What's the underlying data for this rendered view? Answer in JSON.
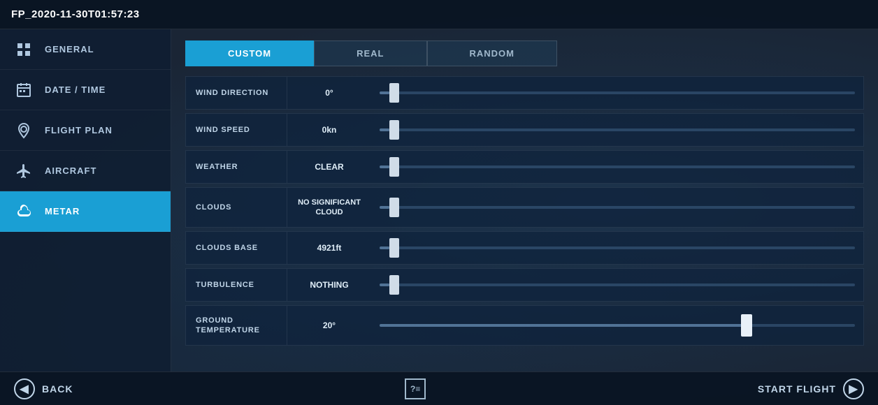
{
  "header": {
    "title": "FP_2020-11-30T01:57:23"
  },
  "sidebar": {
    "items": [
      {
        "id": "general",
        "label": "GENERAL",
        "icon": "grid-icon",
        "active": false
      },
      {
        "id": "datetime",
        "label": "DATE / TIME",
        "icon": "calendar-icon",
        "active": false
      },
      {
        "id": "flightplan",
        "label": "FLIGHT PLAN",
        "icon": "location-icon",
        "active": false
      },
      {
        "id": "aircraft",
        "label": "AIRCRAFT",
        "icon": "plane-icon",
        "active": false
      },
      {
        "id": "metar",
        "label": "METAR",
        "icon": "metar-icon",
        "active": true
      }
    ]
  },
  "tabs": [
    {
      "id": "custom",
      "label": "CUSTOM",
      "active": true
    },
    {
      "id": "real",
      "label": "REAL",
      "active": false
    },
    {
      "id": "random",
      "label": "RANDOM",
      "active": false
    }
  ],
  "settings": {
    "rows": [
      {
        "id": "wind-direction",
        "label": "WIND DIRECTION",
        "value": "0°",
        "thumb_pct": 2
      },
      {
        "id": "wind-speed",
        "label": "WIND SPEED",
        "value": "0kn",
        "thumb_pct": 2
      },
      {
        "id": "weather",
        "label": "WEATHER",
        "value": "CLEAR",
        "thumb_pct": 2
      },
      {
        "id": "clouds",
        "label": "CLOUDS",
        "value": "NO SIGNIFICANT CLOUD",
        "thumb_pct": 2,
        "tall": true
      },
      {
        "id": "clouds-base",
        "label": "CLOUDS BASE",
        "value": "4921ft",
        "thumb_pct": 2
      },
      {
        "id": "turbulence",
        "label": "TURBULENCE",
        "value": "NOTHING",
        "thumb_pct": 2
      },
      {
        "id": "ground-temperature",
        "label": "GROUND TEMPERATURE",
        "value": "20°",
        "thumb_pct": 78,
        "tall": true
      }
    ]
  },
  "footer": {
    "back_label": "BACK",
    "start_label": "START FLIGHT"
  }
}
